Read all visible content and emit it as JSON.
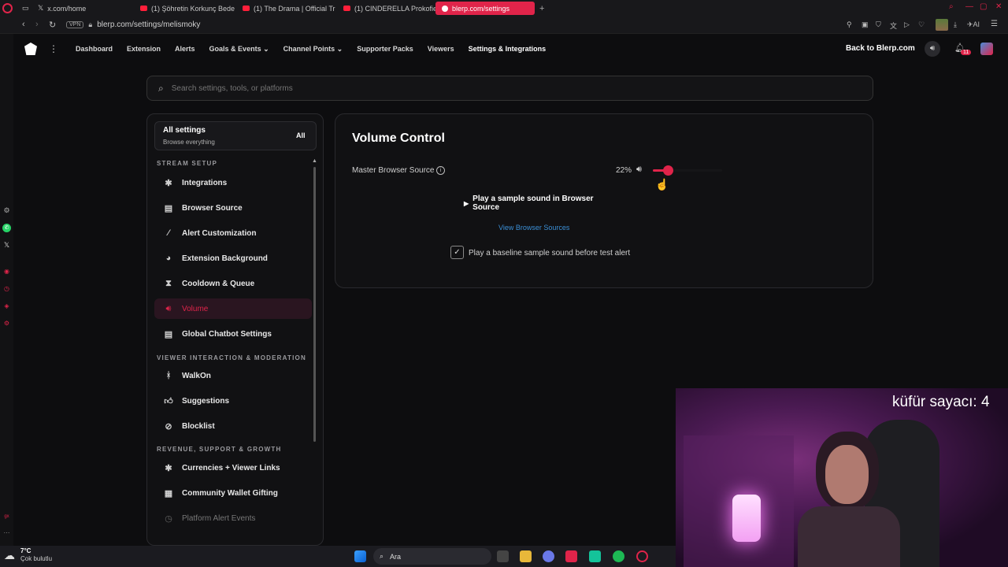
{
  "browser": {
    "tabs": [
      {
        "label": "x.com/home"
      },
      {
        "label": "(1) Şöhretin Korkunç Bede"
      },
      {
        "label": "(1) The Drama | Official Tr"
      },
      {
        "label": "(1) CINDERELLA Prokofiev"
      },
      {
        "label": "blerp.com/settings",
        "active": true
      }
    ],
    "new_tab": "+",
    "url": "blerp.com/settings/melismoky",
    "vpn_label": "VPN",
    "ai_label": "AI"
  },
  "nav": {
    "items": [
      "Dashboard",
      "Extension",
      "Alerts",
      "Goals & Events",
      "Channel Points",
      "Supporter Packs",
      "Viewers",
      "Settings & Integrations"
    ],
    "back_link": "Back to Blerp.com",
    "notif_count": "11"
  },
  "search": {
    "placeholder": "Search settings, tools, or platforms"
  },
  "sidebar": {
    "all_settings_title": "All settings",
    "all_settings_sub": "Browse everything",
    "all_badge": "All",
    "sections": [
      {
        "title": "STREAM SETUP"
      },
      {
        "title": "VIEWER INTERACTION & MODERATION"
      },
      {
        "title": "REVENUE, SUPPORT & GROWTH"
      }
    ],
    "items": [
      {
        "label": "Integrations",
        "icon": "puzzle-icon"
      },
      {
        "label": "Browser Source",
        "icon": "browser-icon"
      },
      {
        "label": "Alert Customization",
        "icon": "magic-wand-icon"
      },
      {
        "label": "Extension Background",
        "icon": "palette-icon"
      },
      {
        "label": "Cooldown & Queue",
        "icon": "hourglass-icon"
      },
      {
        "label": "Volume",
        "icon": "speaker-icon",
        "active": true
      },
      {
        "label": "Global Chatbot Settings",
        "icon": "chat-icon"
      },
      {
        "label": "WalkOn",
        "icon": "footsteps-icon"
      },
      {
        "label": "Suggestions",
        "icon": "thumbs-up-icon"
      },
      {
        "label": "Blocklist",
        "icon": "block-icon"
      },
      {
        "label": "Currencies + Viewer Links",
        "icon": "puzzle-icon"
      },
      {
        "label": "Community Wallet Gifting",
        "icon": "gift-icon"
      },
      {
        "label": "Platform Alert Events",
        "icon": "clock-icon"
      }
    ]
  },
  "volume": {
    "title": "Volume Control",
    "master_label": "Master Browser Source",
    "percent_text": "22%",
    "level": 0.22,
    "play_sample": "Play a sample sound in Browser Source",
    "view_sources": "View Browser Sources",
    "baseline_label": "Play a baseline sample sound before test alert",
    "baseline_checked": true
  },
  "overlay": {
    "counter_text": "küfür sayacı: 4"
  },
  "taskbar": {
    "weather_temp": "7°C",
    "weather_desc": "Çok bulutlu",
    "search_label": "Ara"
  },
  "colors": {
    "accent": "#e0244a",
    "link": "#3b8fd6",
    "bg": "#0d0d0f"
  }
}
